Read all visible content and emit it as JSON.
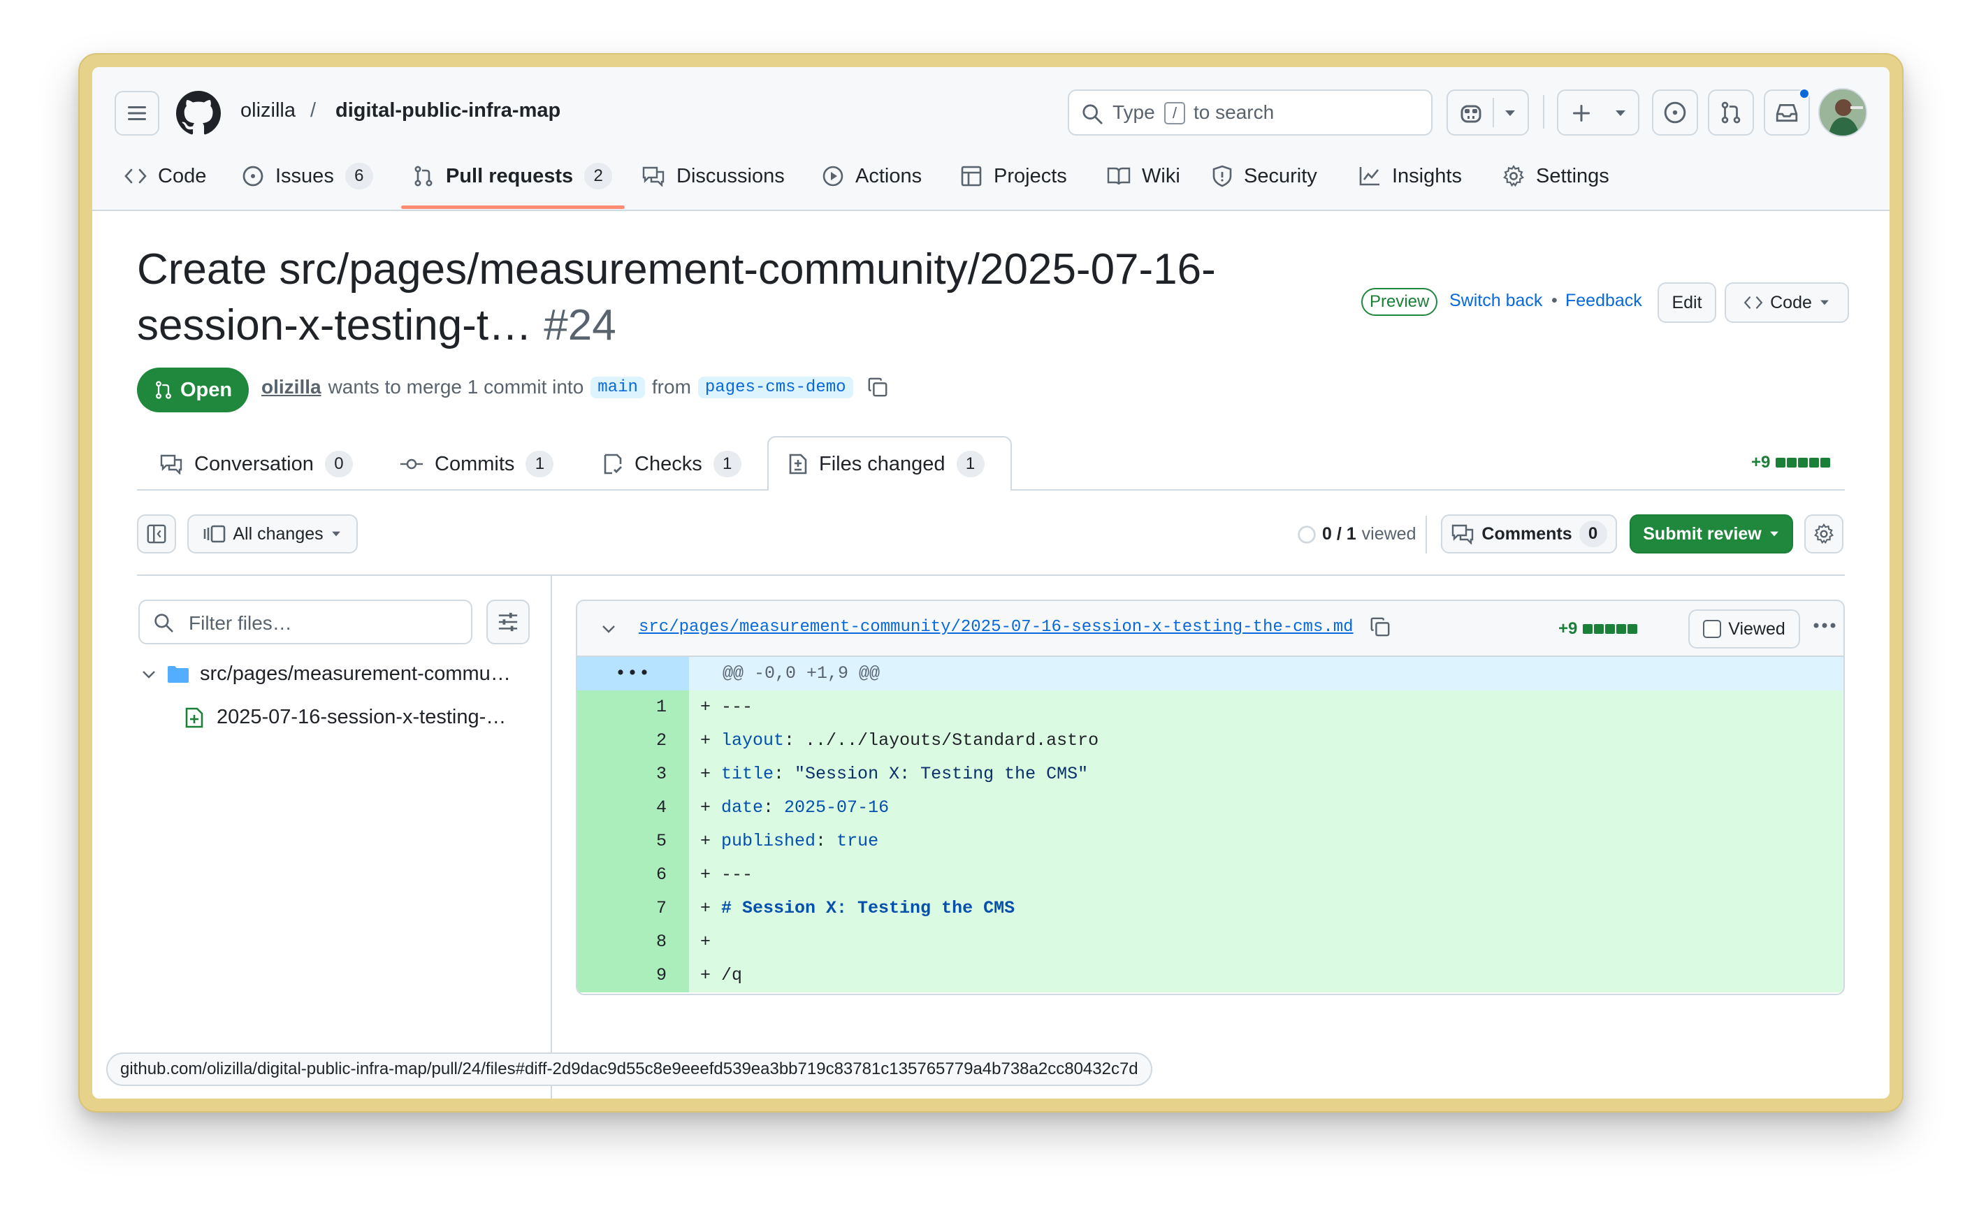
{
  "header": {
    "owner": "olizilla",
    "separator": "/",
    "repo": "digital-public-infra-map",
    "search_prefix": "Type",
    "search_key": "/",
    "search_suffix": "to search"
  },
  "repo_nav": [
    {
      "label": "Code",
      "icon": "code-icon"
    },
    {
      "label": "Issues",
      "icon": "issue-icon",
      "count": "6"
    },
    {
      "label": "Pull requests",
      "icon": "pull-request-icon",
      "count": "2",
      "selected": true
    },
    {
      "label": "Discussions",
      "icon": "discussion-icon"
    },
    {
      "label": "Actions",
      "icon": "play-icon"
    },
    {
      "label": "Projects",
      "icon": "table-icon"
    },
    {
      "label": "Wiki",
      "icon": "book-icon"
    },
    {
      "label": "Security",
      "icon": "shield-icon"
    },
    {
      "label": "Insights",
      "icon": "graph-icon"
    },
    {
      "label": "Settings",
      "icon": "gear-icon"
    }
  ],
  "pr": {
    "title_line1": "Create src/pages/measurement-community/2025-07-16-",
    "title_line2": "session-x-testing-t…",
    "number": "#24",
    "state": "Open",
    "author": "olizilla",
    "merge_text": "wants to merge 1 commit into",
    "base": "main",
    "from_text": "from",
    "head": "pages-cms-demo",
    "preview_badge": "Preview",
    "switch_back": "Switch back",
    "dot": "•",
    "feedback": "Feedback",
    "edit": "Edit",
    "code": "Code"
  },
  "tabs": [
    {
      "label": "Conversation",
      "count": "0",
      "icon": "comment-icon"
    },
    {
      "label": "Commits",
      "count": "1",
      "icon": "commit-icon"
    },
    {
      "label": "Checks",
      "count": "1",
      "icon": "checklist-icon"
    },
    {
      "label": "Files changed",
      "count": "1",
      "icon": "file-diff-icon",
      "selected": true
    }
  ],
  "diffstat_total": "+9",
  "toolbar": {
    "all_changes": "All changes",
    "viewed_count": "0 / 1",
    "viewed_label": "viewed",
    "comments": "Comments",
    "comments_count": "0",
    "submit_review": "Submit review"
  },
  "file_tree": {
    "filter_placeholder": "Filter files…",
    "folder": "src/pages/measurement-commu…",
    "file": "2025-07-16-session-x-testing-…"
  },
  "diff": {
    "path": "src/pages/measurement-community/2025-07-16-session-x-testing-the-cms.md",
    "additions": "+9",
    "viewed": "Viewed",
    "hunk_marker": "•••",
    "hunk": "@@ -0,0 +1,9 @@",
    "lines": [
      {
        "n": "1",
        "prefix": "+ ",
        "key": "",
        "sep": "",
        "val": "---"
      },
      {
        "n": "2",
        "prefix": "+ ",
        "key": "layout",
        "sep": ": ",
        "val": "../../layouts/Standard.astro"
      },
      {
        "n": "3",
        "prefix": "+ ",
        "key": "title",
        "sep": ": ",
        "val": "\"Session X: Testing the CMS\""
      },
      {
        "n": "4",
        "prefix": "+ ",
        "key": "date",
        "sep": ": ",
        "val": "2025-07-16"
      },
      {
        "n": "5",
        "prefix": "+ ",
        "key": "published",
        "sep": ": ",
        "val": "true"
      },
      {
        "n": "6",
        "prefix": "+ ",
        "key": "",
        "sep": "",
        "val": "---"
      },
      {
        "n": "7",
        "prefix": "+ ",
        "key": "",
        "sep": "",
        "val": "# Session X: Testing the CMS"
      },
      {
        "n": "8",
        "prefix": "+",
        "key": "",
        "sep": "",
        "val": ""
      },
      {
        "n": "9",
        "prefix": "+ ",
        "key": "",
        "sep": "",
        "val": "/q"
      }
    ]
  },
  "status_url": "github.com/olizilla/digital-public-infra-map/pull/24/files#diff-2d9dac9d55c8e9eeefd539ea3bb719c83781c135765779a4b738a2cc80432c7d",
  "colors": {
    "accent": "#0969da",
    "success": "#1f883d",
    "add_bg": "#dafbe1",
    "add_num_bg": "#aceebb",
    "selected_underline": "#fd8c73"
  }
}
